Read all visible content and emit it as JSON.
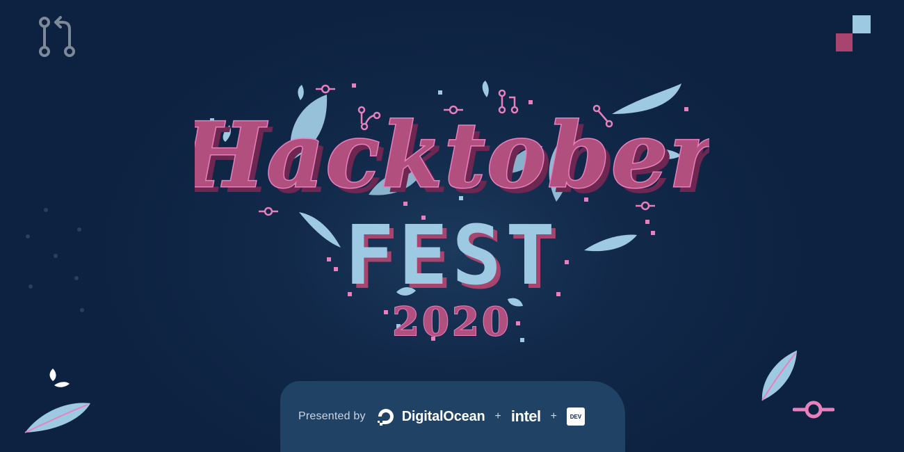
{
  "banner": {
    "title_word": "Hacktober",
    "subtitle_word": "FEST",
    "year": "2020"
  },
  "sponsors": {
    "presented_by": "Presented by",
    "digitalocean": "DigitalOcean",
    "plus_1": "+",
    "intel": "intel",
    "plus_2": "+",
    "dev": "DEV"
  },
  "icons": {
    "top_left": "git-pull-request-icon",
    "top_right": "pixel-squares-icon",
    "bottom_right": "git-commit-icon",
    "decor": "leaf-icon"
  },
  "colors": {
    "background": "#0d2240",
    "pink": "#e880bd",
    "magenta": "#b1507f",
    "light_blue": "#9ec9e2",
    "sponsor_bar": "#1f4265"
  }
}
